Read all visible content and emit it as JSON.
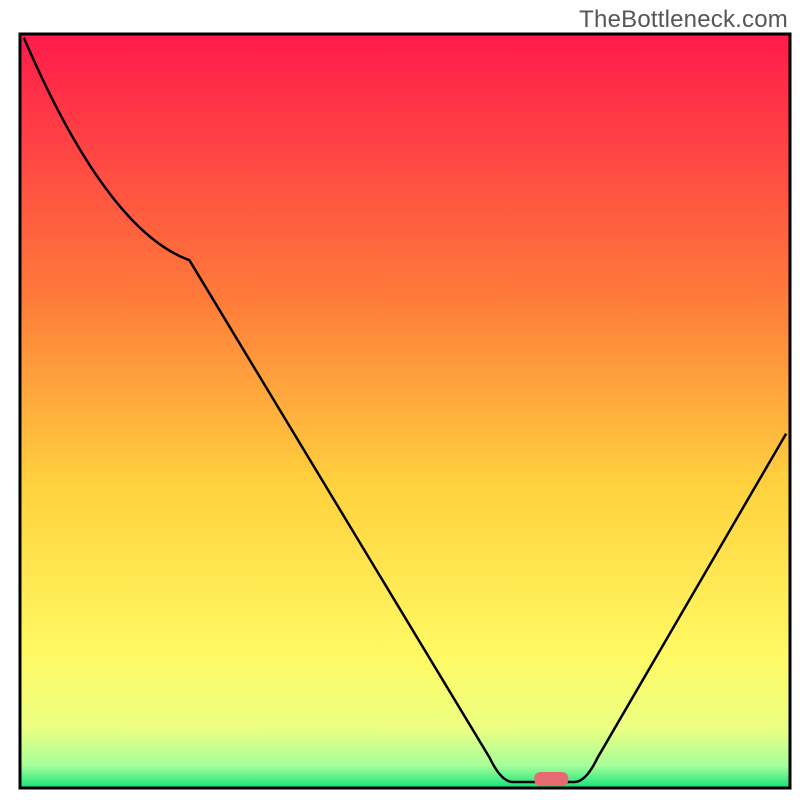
{
  "watermark": "TheBottleneck.com",
  "chart_data": {
    "type": "line",
    "title": "",
    "xlabel": "",
    "ylabel": "",
    "xlim": [
      0,
      100
    ],
    "ylim": [
      0,
      100
    ],
    "series": [
      {
        "name": "bottleneck-curve",
        "points": [
          {
            "x": 0.5,
            "y": 99.5
          },
          {
            "x": 22,
            "y": 70
          },
          {
            "x": 61,
            "y": 4
          },
          {
            "x": 64,
            "y": 0.8
          },
          {
            "x": 72,
            "y": 0.8
          },
          {
            "x": 75,
            "y": 4
          },
          {
            "x": 99.5,
            "y": 47
          }
        ]
      }
    ],
    "marker": {
      "name": "optimal-zone-pill",
      "x": 69,
      "y": 1.2,
      "color": "#e66a70"
    },
    "gradient_stops": [
      {
        "offset": 0,
        "color": "#ff1a4b"
      },
      {
        "offset": 35,
        "color": "#ff7b3a"
      },
      {
        "offset": 60,
        "color": "#ffd23e"
      },
      {
        "offset": 82,
        "color": "#fff962"
      },
      {
        "offset": 92,
        "color": "#ecff82"
      },
      {
        "offset": 97,
        "color": "#a7ff9a"
      },
      {
        "offset": 100,
        "color": "#14e27a"
      }
    ],
    "frame": {
      "stroke": "#000000",
      "stroke_width": 3
    }
  }
}
